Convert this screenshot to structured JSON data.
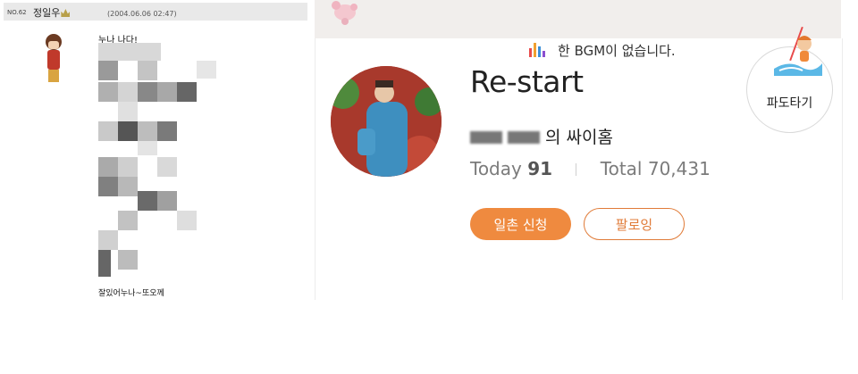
{
  "guestbook": {
    "number": "NO.62",
    "author": "정일우",
    "datetime": "(2004.06.06 02:47)",
    "first_line": "누나 나다!",
    "last_line": "잘있어누나~또오께"
  },
  "profile": {
    "bgm_notice": "한 BGM이 없습니다.",
    "title": "Re-start",
    "owner_suffix": "의 싸이홈",
    "today_label": "Today",
    "today_value": "91",
    "total_label": "Total",
    "total_value": "70,431",
    "ilchon_button": "일촌 신청",
    "follow_button": "팔로잉",
    "wave_badge_label": "파도타기"
  },
  "colors": {
    "accent_orange": "#ef8a3f",
    "follow_border": "#e07b38",
    "banner_bg": "#f1eeec",
    "guestbook_header_bg": "#e9e9e9"
  },
  "icons": [
    "crown-icon",
    "equalizer-icon",
    "profile-photo",
    "surfer-illustration",
    "minime-avatar"
  ]
}
